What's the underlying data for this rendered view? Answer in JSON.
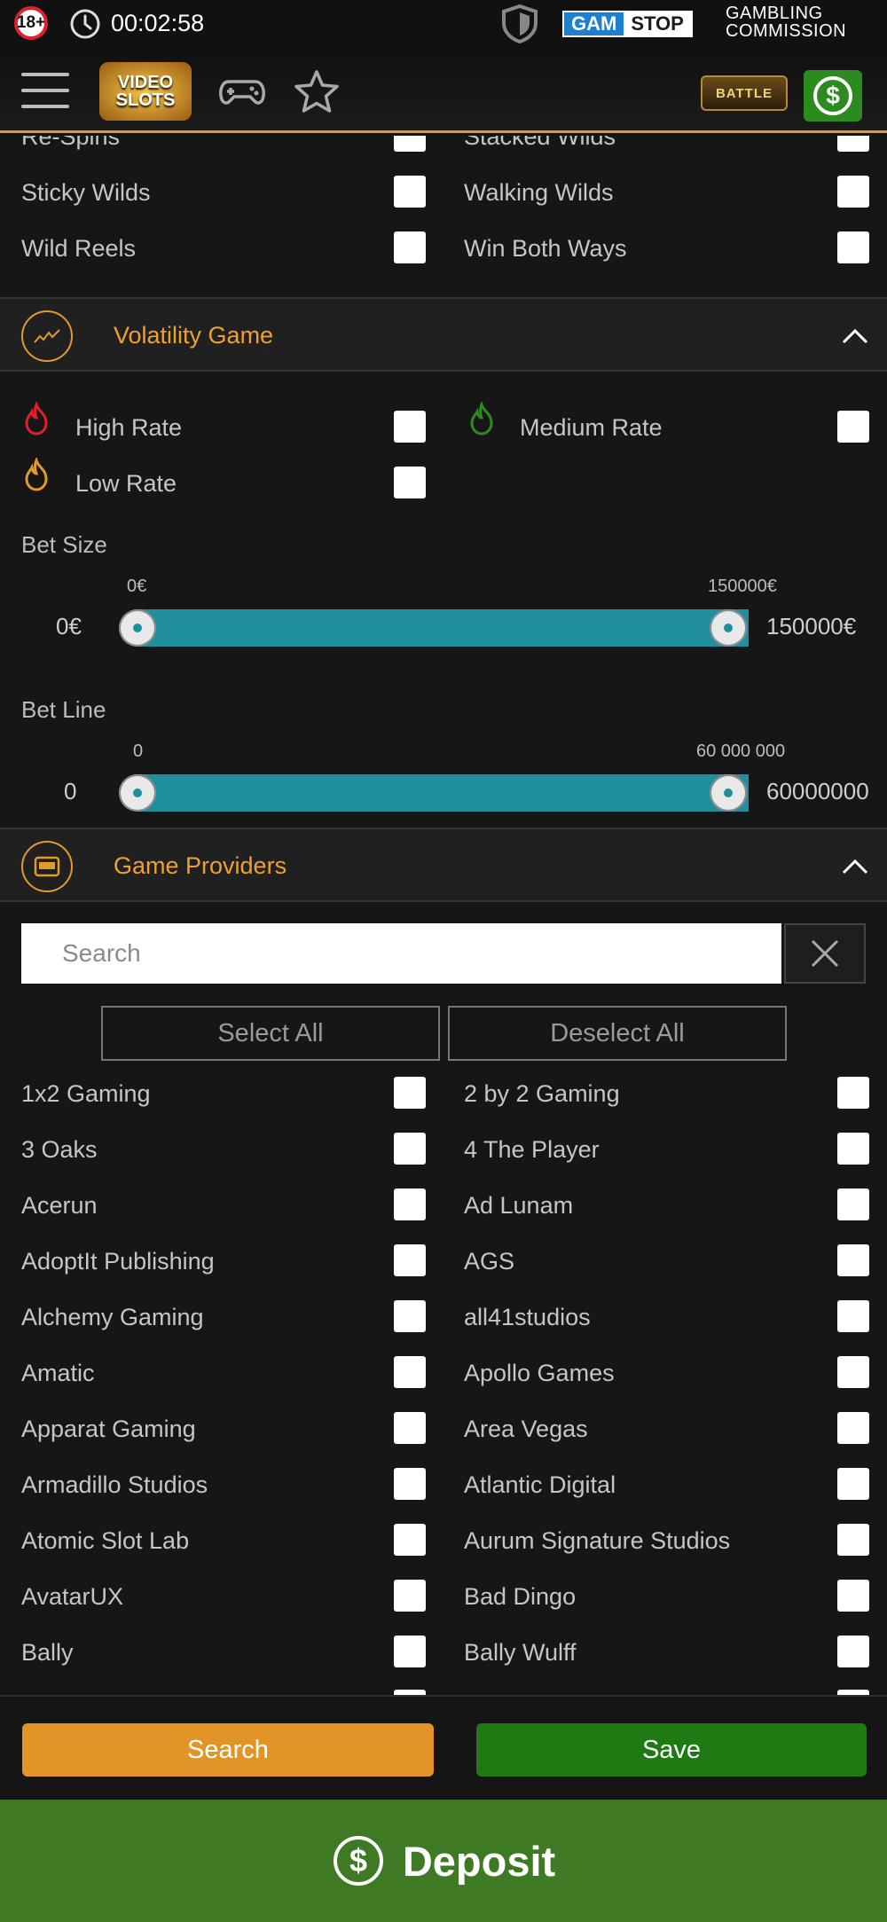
{
  "status_bar": {
    "age_badge": "18+",
    "time": "00:02:58",
    "gamstop_left": "GAM",
    "gamstop_right": "STOP",
    "gambling_commission_line1": "GAMBLING",
    "gambling_commission_line2": "COMMISSION"
  },
  "header": {
    "logo_line1": "VIDEO",
    "logo_line2": "SLOTS",
    "battle_label": "BATTLE"
  },
  "features_rows": [
    {
      "left": "Re-Spins",
      "right": "Stacked Wilds"
    },
    {
      "left": "Sticky Wilds",
      "right": "Walking Wilds"
    },
    {
      "left": "Wild Reels",
      "right": "Win Both Ways"
    }
  ],
  "volatility": {
    "title": "Volatility Game",
    "high": "High Rate",
    "medium": "Medium Rate",
    "low": "Low Rate"
  },
  "bet_size": {
    "label": "Bet Size",
    "min_top": "0€",
    "max_top": "150000€",
    "min_side": "0€",
    "max_side": "150000€",
    "low_fraction": 0,
    "high_fraction": 1
  },
  "bet_line": {
    "label": "Bet Line",
    "min_top": "0",
    "max_top": "60 000 000",
    "min_side": "0",
    "max_side": "60000000",
    "low_fraction": 0,
    "high_fraction": 1
  },
  "providers": {
    "title": "Game Providers",
    "search_placeholder": "Search",
    "select_all": "Select All",
    "deselect_all": "Deselect All",
    "rows": [
      {
        "left": "1x2 Gaming",
        "right": "2 by 2 Gaming"
      },
      {
        "left": "3 Oaks",
        "right": "4 The Player"
      },
      {
        "left": "Acerun",
        "right": "Ad Lunam"
      },
      {
        "left": "AdoptIt Publishing",
        "right": "AGS"
      },
      {
        "left": "Alchemy Gaming",
        "right": "all41studios"
      },
      {
        "left": "Amatic",
        "right": "Apollo Games"
      },
      {
        "left": "Apparat Gaming",
        "right": "Area Vegas"
      },
      {
        "left": "Armadillo Studios",
        "right": "Atlantic Digital"
      },
      {
        "left": "Atomic Slot Lab",
        "right": "Aurum Signature Studios"
      },
      {
        "left": "AvatarUX",
        "right": "Bad Dingo"
      },
      {
        "left": "Bally",
        "right": "Bally Wulff"
      }
    ]
  },
  "footer": {
    "search_label": "Search",
    "save_label": "Save",
    "deposit_label": "Deposit"
  },
  "colors": {
    "accent_orange": "#eea12e",
    "slider_teal": "#1f8fa0",
    "save_green": "#207a14",
    "deposit_green": "#3d7a23",
    "high_rate_red": "#e0202a",
    "medium_rate_green": "#2c8b1f",
    "low_rate_orange": "#e29a2a"
  },
  "icons": [
    "age-18-icon",
    "clock-icon",
    "shield-icon",
    "menu-icon",
    "gamepad-icon",
    "star-icon",
    "dollar-icon",
    "flame-icon",
    "volatility-chart-icon",
    "slot-machine-icon",
    "chevron-up-icon",
    "close-icon"
  ]
}
